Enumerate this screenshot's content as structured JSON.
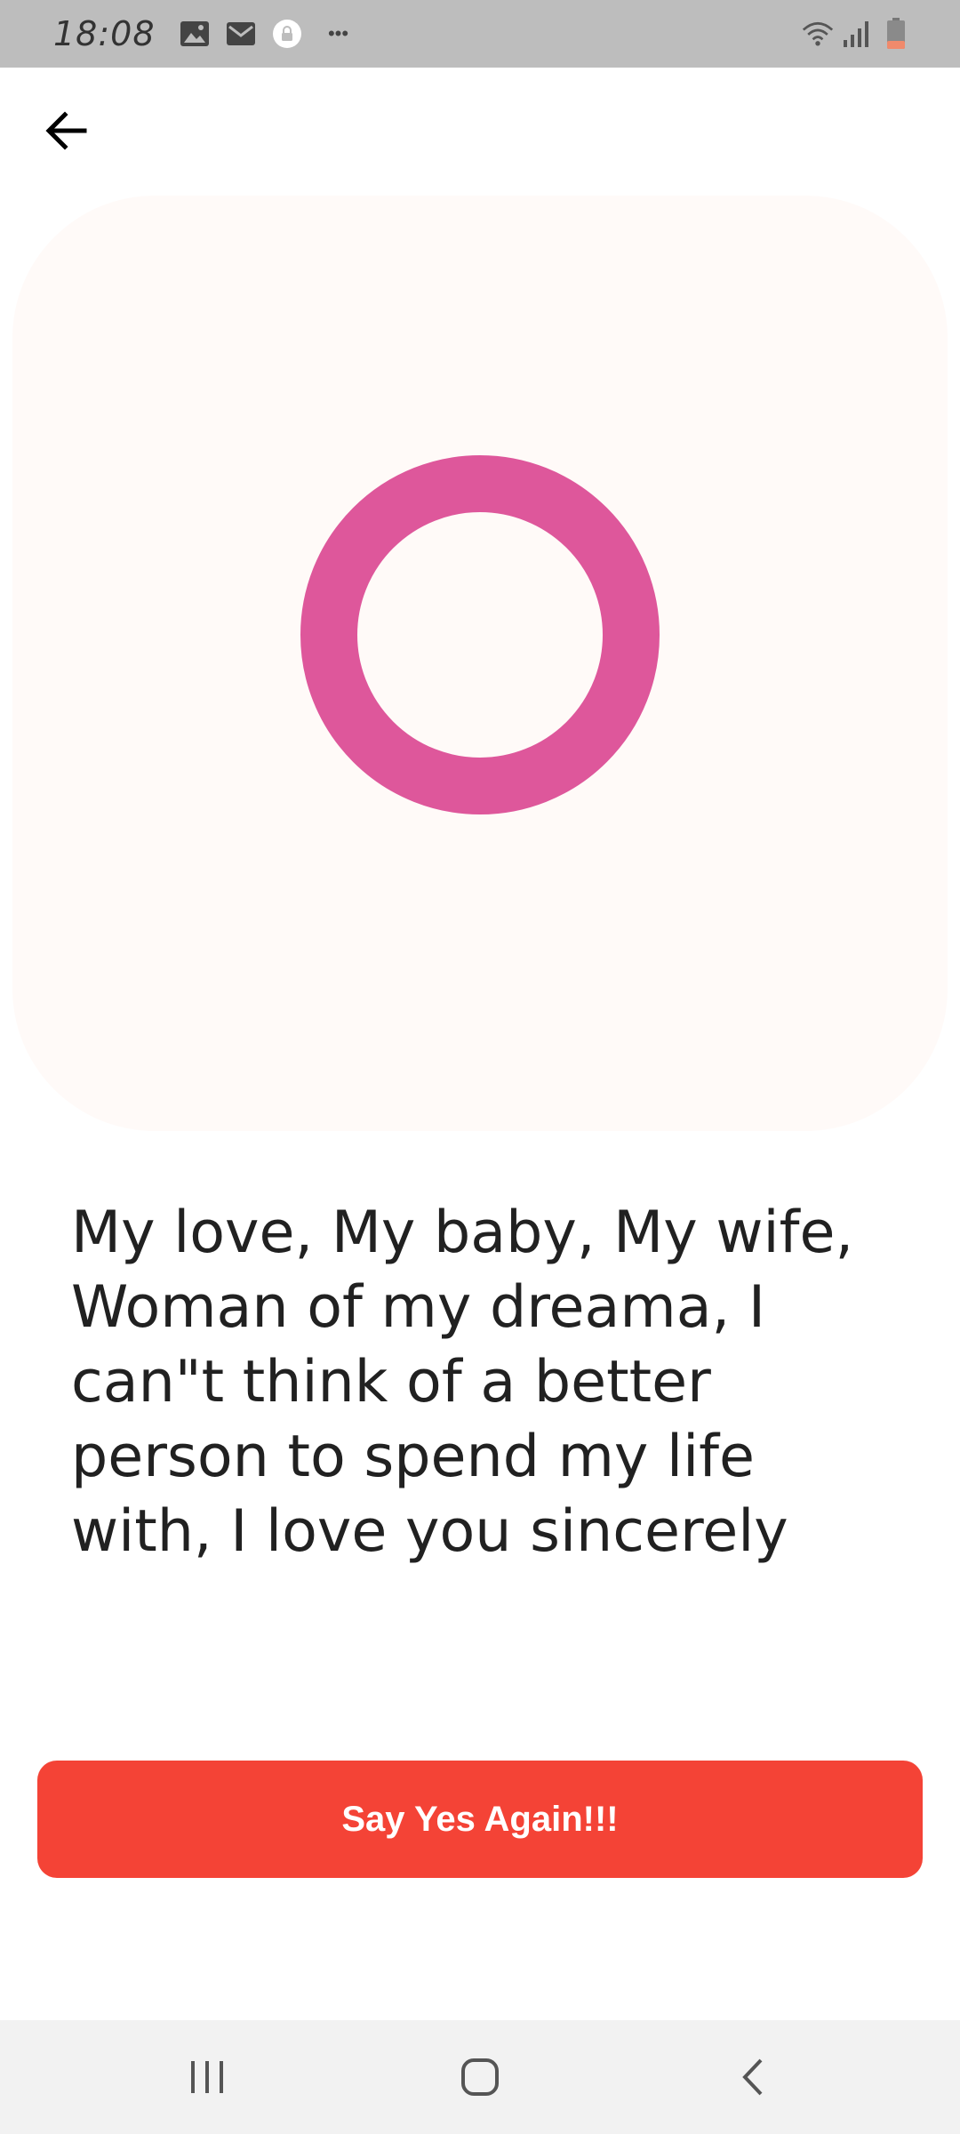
{
  "status_bar": {
    "time": "18:08",
    "left_icons": [
      "image-icon",
      "mail-icon",
      "lock-badge-icon",
      "more-dots-icon"
    ],
    "right_icons": [
      "wifi-icon",
      "signal-icon",
      "battery-icon"
    ],
    "more_text": "•••"
  },
  "header": {
    "back_icon": "arrow-left-icon"
  },
  "hero": {
    "ring_color": "#de579b",
    "card_color": "#fffaf8"
  },
  "message": {
    "text": "My love, My baby, My wife, Woman of my dreama, I can\"t think of a better person to spend my life with, I love you sincerely"
  },
  "cta": {
    "label": "Say Yes Again!!!",
    "color": "#f44336"
  },
  "nav": {
    "icons": [
      "recent-apps-icon",
      "home-icon",
      "back-icon"
    ]
  }
}
